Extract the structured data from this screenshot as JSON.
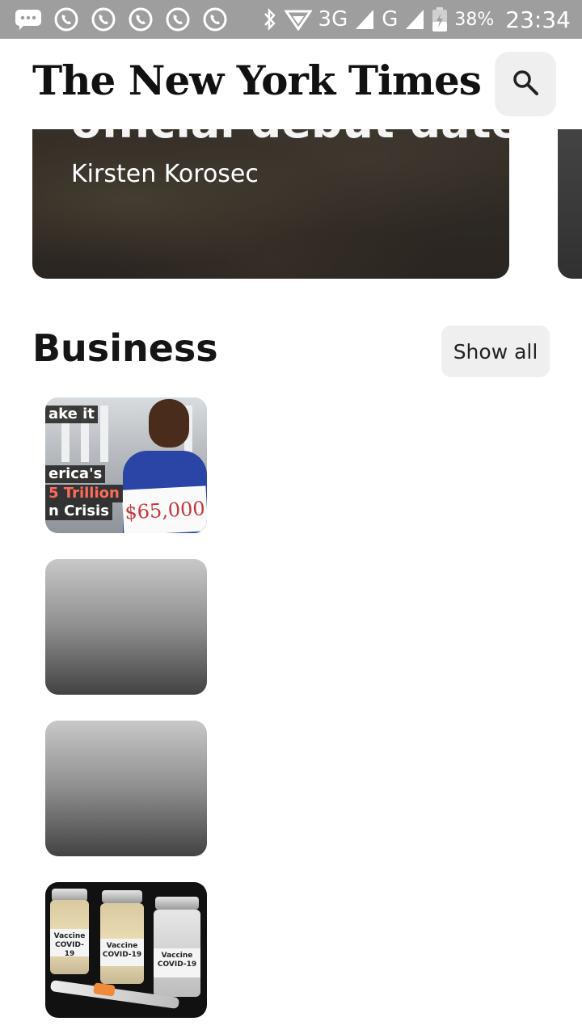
{
  "status_bar": {
    "network_3g": "3G",
    "network_g": "G",
    "battery": "38%",
    "time": "23:34"
  },
  "header": {
    "logo_text": "The New York Times"
  },
  "hero": {
    "title_partial": "official debut date",
    "author": "Kirsten Korosec"
  },
  "section": {
    "title": "Business",
    "show_all": "Show all"
  },
  "thumbnails": {
    "loan": {
      "line1": "ake it",
      "line2": "erica's",
      "line3": "5 Trillion",
      "line4": "n Crisis",
      "sign": "$65,000"
    },
    "vaccine": {
      "label_a": "Vaccine COVID-19",
      "label_b": "Vaccine COVID-19",
      "label_c": "Vaccine COVID-19"
    }
  }
}
